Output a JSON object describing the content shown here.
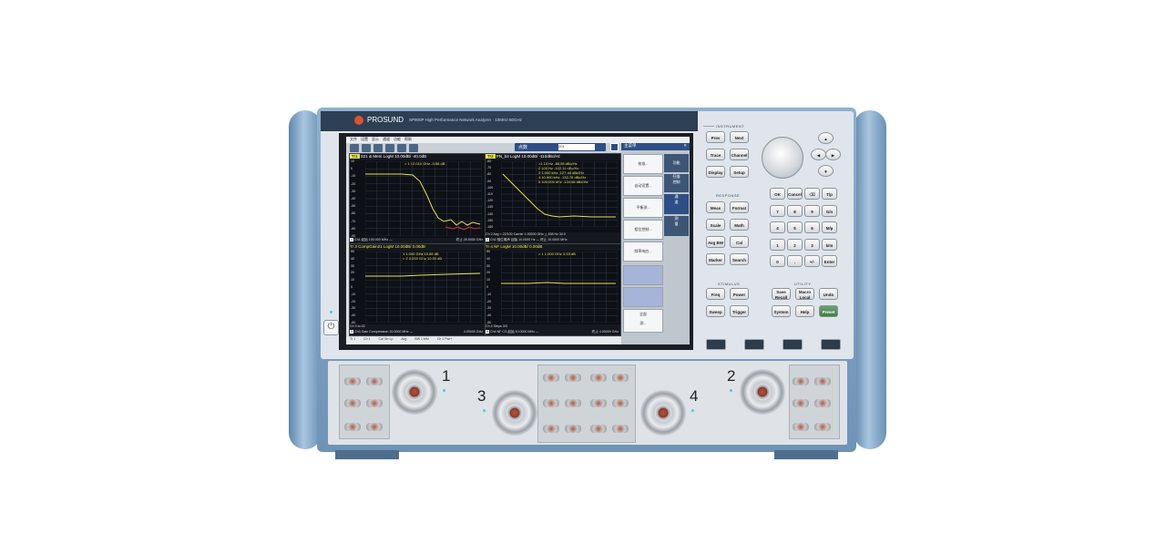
{
  "brand": "PROSUND",
  "model_title": "SP900P  High  Performance  Network  Analyzer  ·  10MHz-50GHz",
  "menu": [
    "文件",
    "设置",
    "显示",
    "通道",
    "功能",
    "帮助"
  ],
  "meas_bar": {
    "label": "点数",
    "value": "201"
  },
  "traces": [
    {
      "title": "S21 & Mem LogM 10.00dB/ -40.0dB",
      "marker_line": "> 1     12.010  GHz          -0.58 dB",
      "y_ticks": [
        "10",
        "0",
        "-10",
        "-20",
        "-30",
        "-40",
        "-50",
        "-60",
        "-70",
        "-80",
        "-90"
      ],
      "footer_left": "Ch1  起始  100.000 MHz —",
      "footer_right": "终止  26.5000 GHz",
      "num": "1"
    },
    {
      "title": "PN_b3 LogM 10.00dB/ -110dBc/Hz",
      "markers": [
        ">1      10 Hz    -88.05 dBc/Hz",
        "2      100 Hz  -102.11 dBc/Hz",
        "3    1.000 kHz  -127.44 dBc/Hz",
        "4   10.000 kHz  -133.75 dBc/Hz",
        "5  100.000 kHz  -134.58 dBc/Hz"
      ],
      "y_ticks": [
        "-60",
        "-70",
        "-80",
        "-90",
        "-100",
        "-110",
        "-120",
        "-130",
        "-140",
        "-150",
        "-160"
      ],
      "footer_left": "Ch 2  Avg = 22/100  Carrier 1.00000 GHz  △ 458 Hz   30.0",
      "footer_right": "Ch2  相位噪声  起始  10.0000 Hz —     终止  10.0000 MHz",
      "num": "2"
    },
    {
      "title": "Tr 3  CompGain21 LogM 10.00dB/ 0.00dB",
      "markers": [
        "1      1.000  GHz       10.85 dB",
        "> 2    3.000  GHz       19.00 dB"
      ],
      "y_ticks": [
        "50",
        "40",
        "30",
        "20",
        "10",
        "0",
        "-10",
        "-20",
        "-30",
        "-40",
        "-50"
      ],
      "footer_left": "Ch3  Gain Compression  10.0000 MHz —",
      "footer_right": "4.00000 GHz",
      "pre_footer": "Ch 3  to 02",
      "num": "3"
    },
    {
      "title": "Tr 4  NF LogM 10.00dB/ 0.00dB",
      "markers": [
        "> 1     1.000  GHz        3.53 dB"
      ],
      "y_ticks": [
        "50",
        "40",
        "30",
        "20",
        "10",
        "0",
        "-10",
        "-20",
        "-30",
        "-40",
        "-50"
      ],
      "footer_left": "Ch4  NF CS  起始  10.0000 MHz —",
      "footer_right": "终止  4.00000 GHz",
      "pre_footer": "Ch 4  Steps  3/3",
      "num": "4"
    }
  ],
  "side_panel": {
    "header": "主菜单",
    "buttons": [
      "校准...",
      "自动设置...",
      "平衡测...",
      "相位控制...",
      "频率响应...",
      "",
      "",
      "全部\n测..."
    ],
    "tabs": [
      "功能",
      "扫描\n控制",
      "通\n道",
      "测\n量"
    ]
  },
  "status_bar": [
    "Tr 1",
    "Ch 1",
    "Cal On·Lp",
    "Avg",
    "BW 1 kHz",
    "Ch 1 Pwr+"
  ],
  "status_sub": [
    "Meas",
    "System",
    "Tr+Ref"
  ],
  "keypad": {
    "instrument_label": "INSTRUMENT",
    "instrument": [
      "Prev",
      "Next",
      "Trace",
      "Channel",
      "Display",
      "Setup"
    ],
    "response_label": "RESPONSE",
    "response": [
      "Meas",
      "Format",
      "Scale",
      "Math",
      "Avg BW",
      "Cal",
      "Marker",
      "Search"
    ],
    "stimulus_label": "STIMULUS",
    "stimulus": [
      "Freq",
      "Power",
      "Sweep",
      "Trigger"
    ],
    "utility_label": "UTILITY",
    "utility": [
      "Save\nRecall",
      "Macro\nLocal",
      "Undo",
      "System",
      "Help",
      "Preset"
    ],
    "numpad": [
      "OK",
      "Cancel",
      "⌫",
      "T/p",
      "7",
      "8",
      "9",
      "G/n",
      "4",
      "5",
      "6",
      "M/µ",
      "1",
      "2",
      "3",
      "k/m",
      "0",
      ".",
      "+/-",
      "Enter"
    ]
  },
  "port_numbers": [
    "1",
    "2",
    "3",
    "4"
  ],
  "colors": {
    "trace_yellow": "#e8e04a",
    "trace_red": "#d2322a",
    "panel_bg": "#0d1016",
    "chassis_blue": "#7397ba",
    "preset_green": "#4c8a55"
  }
}
